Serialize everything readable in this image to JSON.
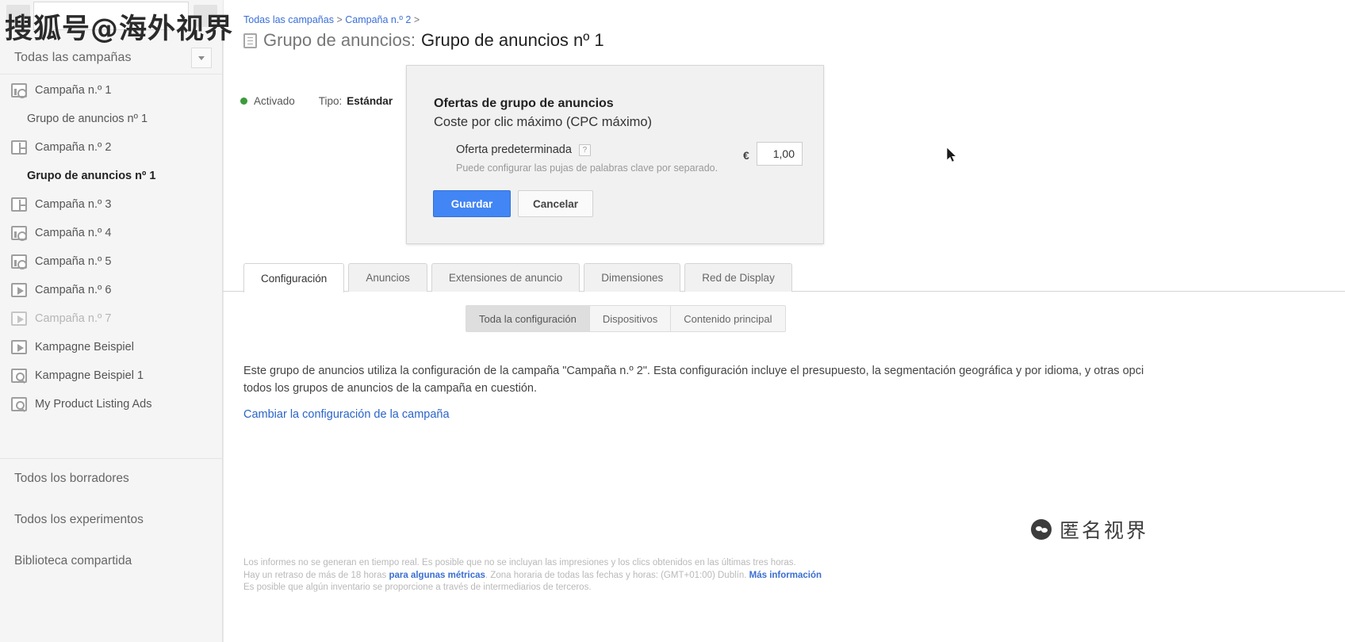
{
  "sidebar": {
    "header_label": "Todas las campañas",
    "items": [
      {
        "label": "Campaña n.º 1",
        "icon": "display-network-icon",
        "level": 0,
        "state": "normal"
      },
      {
        "label": "Grupo de anuncios nº 1",
        "icon": "none",
        "level": 1,
        "state": "normal"
      },
      {
        "label": "Campaña n.º 2",
        "icon": "search-display-icon",
        "level": 0,
        "state": "normal"
      },
      {
        "label": "Grupo de anuncios nº 1",
        "icon": "none",
        "level": 1,
        "state": "selected"
      },
      {
        "label": "Campaña n.º 3",
        "icon": "search-display-icon",
        "level": 0,
        "state": "normal"
      },
      {
        "label": "Campaña n.º 4",
        "icon": "display-network-icon",
        "level": 0,
        "state": "normal"
      },
      {
        "label": "Campaña n.º 5",
        "icon": "display-network-icon",
        "level": 0,
        "state": "normal"
      },
      {
        "label": "Campaña n.º 6",
        "icon": "video-icon",
        "level": 0,
        "state": "normal"
      },
      {
        "label": "Campaña n.º 7",
        "icon": "video-icon",
        "level": 0,
        "state": "disabled"
      },
      {
        "label": "Kampagne Beispiel",
        "icon": "video-icon",
        "level": 0,
        "state": "normal"
      },
      {
        "label": "Kampagne Beispiel 1",
        "icon": "shopping-search-icon",
        "level": 0,
        "state": "normal"
      },
      {
        "label": "My Product Listing Ads",
        "icon": "shopping-search-icon",
        "level": 0,
        "state": "normal"
      }
    ],
    "links": [
      {
        "label": "Todos los borradores"
      },
      {
        "label": "Todos los experimentos"
      },
      {
        "label": "Biblioteca compartida"
      }
    ]
  },
  "breadcrumb": {
    "items": [
      "Todas las campañas",
      "Campaña n.º 2"
    ],
    "separator": ">",
    "trailing": ">"
  },
  "page": {
    "title_label": "Grupo de anuncios:",
    "title_value": "Grupo de anuncios nº 1",
    "title_icon": "ad-group-icon"
  },
  "status": {
    "dot_color": "#3c9a3c",
    "state_label": "Activado",
    "type_label": "Tipo:",
    "type_value": "Estándar"
  },
  "bid_panel": {
    "title": "Ofertas de grupo de anuncios",
    "subtitle": "Coste por clic máximo (CPC máximo)",
    "field_label": "Oferta predeterminada",
    "help_glyph": "?",
    "hint": "Puede configurar las pujas de palabras clave por separado.",
    "currency_symbol": "€",
    "bid_value": "1,00",
    "save_label": "Guardar",
    "cancel_label": "Cancelar",
    "save_color": "#4285f4"
  },
  "tabs": [
    {
      "label": "Configuración",
      "active": true
    },
    {
      "label": "Anuncios",
      "active": false
    },
    {
      "label": "Extensiones de anuncio",
      "active": false
    },
    {
      "label": "Dimensiones",
      "active": false
    },
    {
      "label": "Red de Display",
      "active": false
    }
  ],
  "subtabs": [
    {
      "label": "Toda la configuración",
      "active": true
    },
    {
      "label": "Dispositivos",
      "active": false
    },
    {
      "label": "Contenido principal",
      "active": false
    }
  ],
  "content": {
    "paragraph_line1": "Este grupo de anuncios utiliza la configuración de la campaña \"Campaña n.º 2\". Esta configuración incluye el presupuesto, la segmentación geográfica y por idioma, y otras opci",
    "paragraph_line2": "todos los grupos de anuncios de la campaña en cuestión.",
    "change_link": "Cambiar la configuración de la campaña"
  },
  "footer": {
    "line1": "Los informes no se generan en tiempo real. Es posible que no se incluyan las impresiones y los clics obtenidos en las últimas tres horas.",
    "line2_a": "Hay un retraso de más de 18 horas ",
    "line2_link1": "para algunas métricas",
    "line2_b": ". Zona horaria de todas las fechas y horas: (GMT+01:00) Dublín. ",
    "line2_link2": "Más información",
    "line3": "Es posible que algún inventario se proporcione a través de intermediarios de terceros."
  },
  "watermarks": {
    "top_left": "搜狐号@海外视界",
    "bottom_right": "匿名视界"
  }
}
